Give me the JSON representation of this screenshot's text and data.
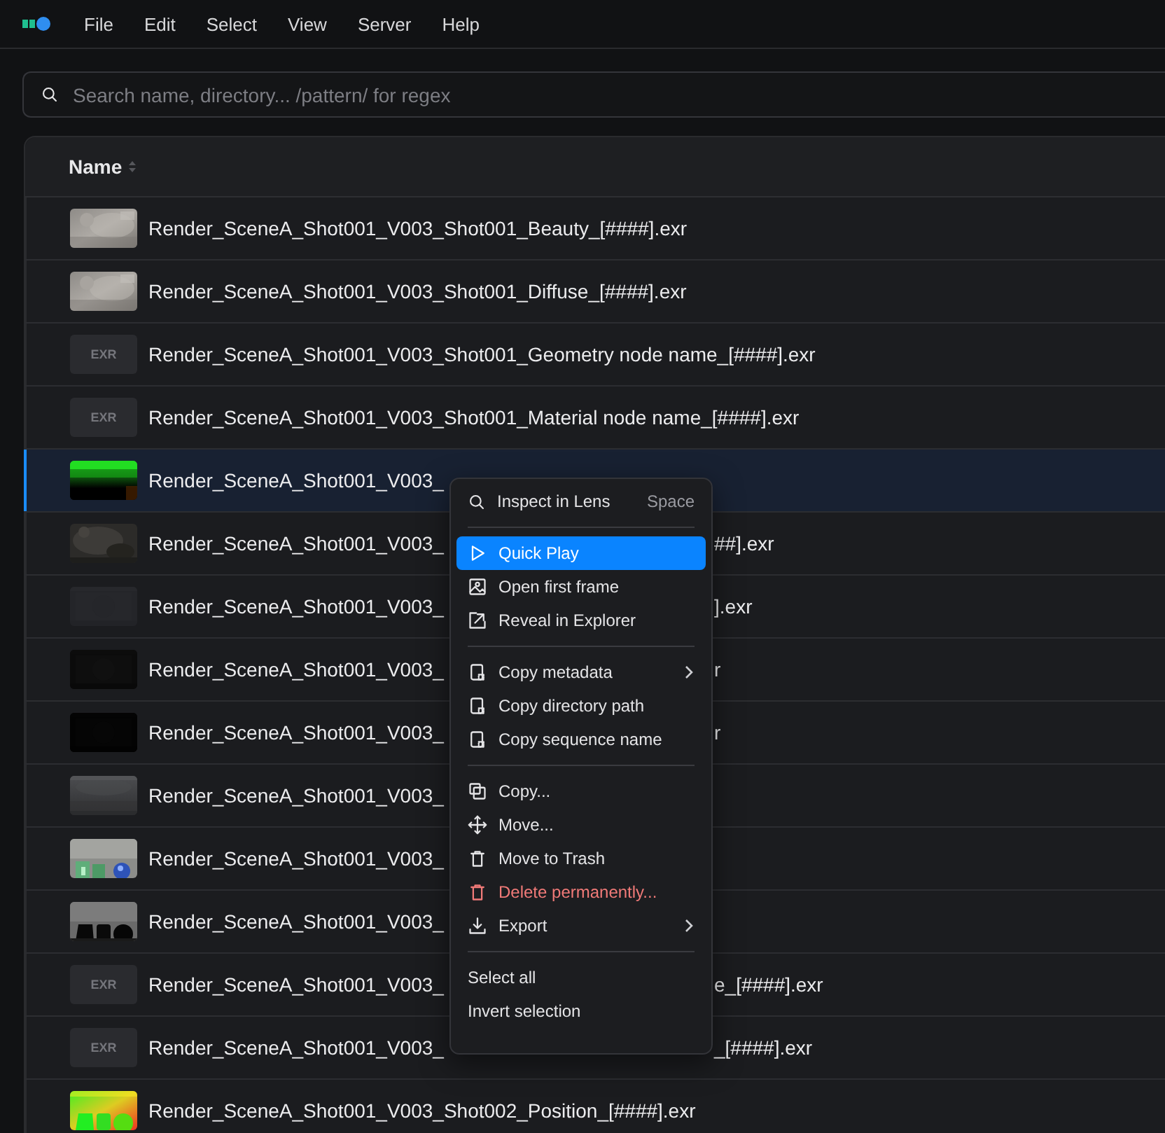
{
  "menubar": {
    "items": [
      "File",
      "Edit",
      "Select",
      "View",
      "Server",
      "Help"
    ]
  },
  "search": {
    "placeholder": "Search name, directory... /pattern/ for regex"
  },
  "table": {
    "columns": [
      {
        "label": "Name",
        "sortable": true
      }
    ],
    "rows": [
      {
        "name": "Render_SceneA_Shot001_V003_Shot001_Beauty_[####].exr",
        "selected": false
      },
      {
        "name": "Render_SceneA_Shot001_V003_Shot001_Diffuse_[####].exr",
        "selected": false
      },
      {
        "thumb": {
          "kind": "placeholder",
          "label": "EXR"
        },
        "name": "Render_SceneA_Shot001_V003_Shot001_Geometry node name_[####].exr",
        "selected": false
      },
      {
        "thumb": {
          "kind": "placeholder",
          "label": "EXR"
        },
        "name": "Render_SceneA_Shot001_V003_Shot001_Material node name_[####].exr",
        "selected": false
      },
      {
        "name": "Render_SceneA_Shot001_V003_",
        "selected": true
      },
      {
        "name": "Render_SceneA_Shot001_V003_",
        "tail": "##].exr",
        "selected": false
      },
      {
        "name": "Render_SceneA_Shot001_V003_",
        "tail": "].exr",
        "selected": false
      },
      {
        "name": "Render_SceneA_Shot001_V003_",
        "tail": "r",
        "selected": false
      },
      {
        "name": "Render_SceneA_Shot001_V003_",
        "tail": "r",
        "selected": false
      },
      {
        "name": "Render_SceneA_Shot001_V003_",
        "selected": false
      },
      {
        "name": "Render_SceneA_Shot001_V003_",
        "selected": false
      },
      {
        "name": "Render_SceneA_Shot001_V003_",
        "selected": false
      },
      {
        "thumb": {
          "kind": "placeholder",
          "label": "EXR"
        },
        "name": "Render_SceneA_Shot001_V003_",
        "tail": "e_[####].exr",
        "selected": false
      },
      {
        "thumb": {
          "kind": "placeholder",
          "label": "EXR"
        },
        "name": "Render_SceneA_Shot001_V003_",
        "tail": "_[####].exr",
        "selected": false
      },
      {
        "name": "Render_SceneA_Shot001_V003_Shot002_Position_[####].exr",
        "selected": false
      }
    ]
  },
  "context_menu": {
    "groups": [
      [
        {
          "label": "Inspect in Lens",
          "shortcut": "Space",
          "selected": false,
          "danger": false,
          "submenu": false
        }
      ],
      [
        {
          "label": "Quick Play",
          "selected": true,
          "danger": false,
          "submenu": false
        },
        {
          "label": "Open first frame",
          "selected": false,
          "danger": false,
          "submenu": false
        },
        {
          "label": "Reveal in Explorer",
          "selected": false,
          "danger": false,
          "submenu": false
        }
      ],
      [
        {
          "label": "Copy metadata",
          "selected": false,
          "danger": false,
          "submenu": true
        },
        {
          "label": "Copy directory path",
          "selected": false,
          "danger": false,
          "submenu": false
        },
        {
          "label": "Copy sequence name",
          "selected": false,
          "danger": false,
          "submenu": false
        }
      ],
      [
        {
          "label": "Copy...",
          "selected": false,
          "danger": false,
          "submenu": false
        },
        {
          "label": "Move...",
          "selected": false,
          "danger": false,
          "submenu": false
        },
        {
          "label": "Move to Trash",
          "selected": false,
          "danger": false,
          "submenu": false
        },
        {
          "label": "Delete permanently...",
          "selected": false,
          "danger": true,
          "submenu": false
        },
        {
          "label": "Export",
          "selected": false,
          "danger": false,
          "submenu": true
        }
      ],
      [
        {
          "label": "Select all",
          "selected": false,
          "danger": false,
          "submenu": false
        },
        {
          "label": "Invert selection",
          "selected": false,
          "danger": false,
          "submenu": false
        }
      ]
    ]
  }
}
